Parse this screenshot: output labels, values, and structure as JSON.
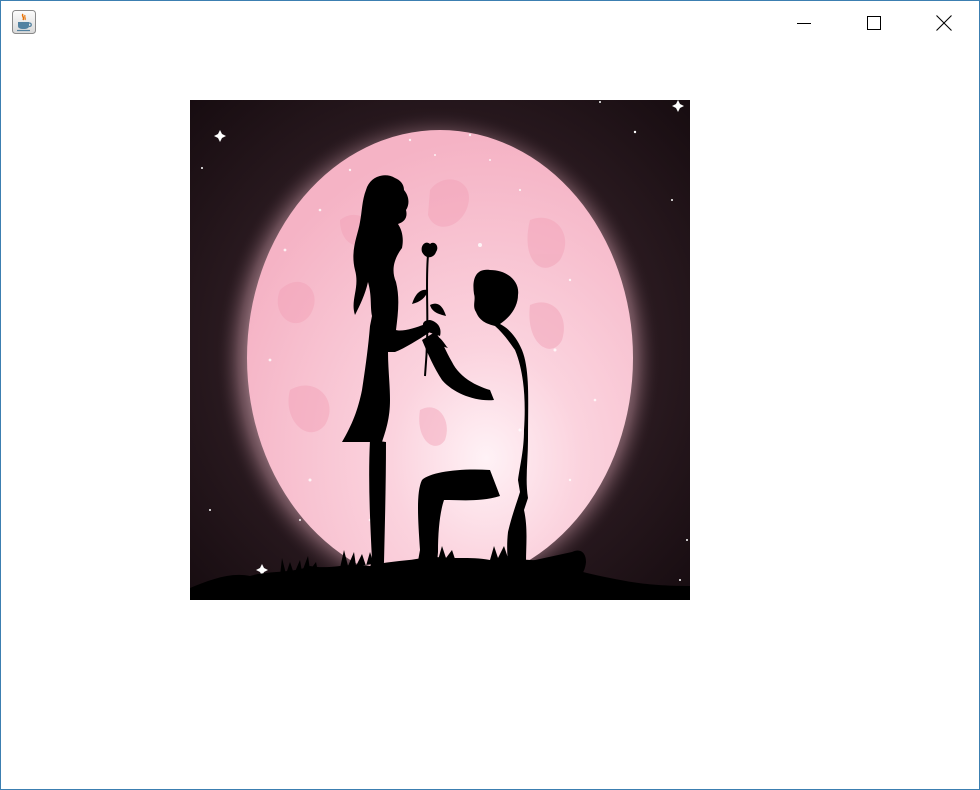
{
  "window": {
    "title": "",
    "controls": {
      "minimize_icon": "minimize-icon",
      "maximize_icon": "maximize-icon",
      "close_icon": "close-icon"
    },
    "app_icon": "java-coffee-cup-icon"
  },
  "image": {
    "description_icon": "couple-proposal-moon-image",
    "colors": {
      "background": "#1a0f14",
      "moon": "#f7b9c8",
      "moon_center": "#ffe6ee",
      "silhouette": "#000000"
    }
  }
}
